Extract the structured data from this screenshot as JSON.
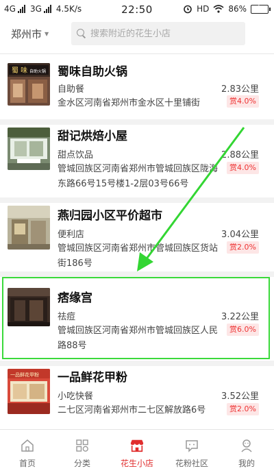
{
  "status": {
    "network1": "4G",
    "network2": "3G",
    "speed": "4.5K/s",
    "time": "22:50",
    "hd": "HD",
    "battery": "86%"
  },
  "header": {
    "city": "郑州市",
    "search_placeholder": "搜索附近的花生小店"
  },
  "shops": [
    {
      "name": "蜀味自助火锅",
      "category": "自助餐",
      "address": "金水区河南省郑州市金水区十里铺街",
      "distance": "2.83公里",
      "reward": "赏4.0%",
      "thumb_text": "蜀 味",
      "thumb_sub": "自助火锅"
    },
    {
      "name": "甜记烘焙小屋",
      "category": "甜点饮品",
      "address": "管城回族区河南省郑州市管城回族区陇海东路66号15号楼1-2层03号66号",
      "distance": "2.88公里",
      "reward": "赏4.0%"
    },
    {
      "name": "燕归园小区平价超市",
      "category": "便利店",
      "address": "管城回族区河南省郑州市管城回族区货站街186号",
      "distance": "3.04公里",
      "reward": "赏2.0%"
    },
    {
      "name": "痞缘宫",
      "category": "祛痘",
      "address": "管城回族区河南省郑州市管城回族区人民路88号",
      "distance": "3.22公里",
      "reward": "赏6.0%"
    },
    {
      "name": "一品鲜花甲粉",
      "category": "小吃快餐",
      "address": "二七区河南省郑州市二七区解放路6号",
      "distance": "3.52公里",
      "reward": "赏2.0%",
      "thumb_text": "一品鲜花甲粉"
    }
  ],
  "nav": [
    {
      "label": "首页",
      "icon": "home-icon"
    },
    {
      "label": "分类",
      "icon": "grid-icon"
    },
    {
      "label": "花生小店",
      "icon": "store-icon",
      "active": true
    },
    {
      "label": "花粉社区",
      "icon": "community-icon"
    },
    {
      "label": "我的",
      "icon": "profile-icon"
    }
  ],
  "colors": {
    "accent": "#e02e2e",
    "highlight": "#3ad93a",
    "badge_bg": "#fde6e6"
  }
}
